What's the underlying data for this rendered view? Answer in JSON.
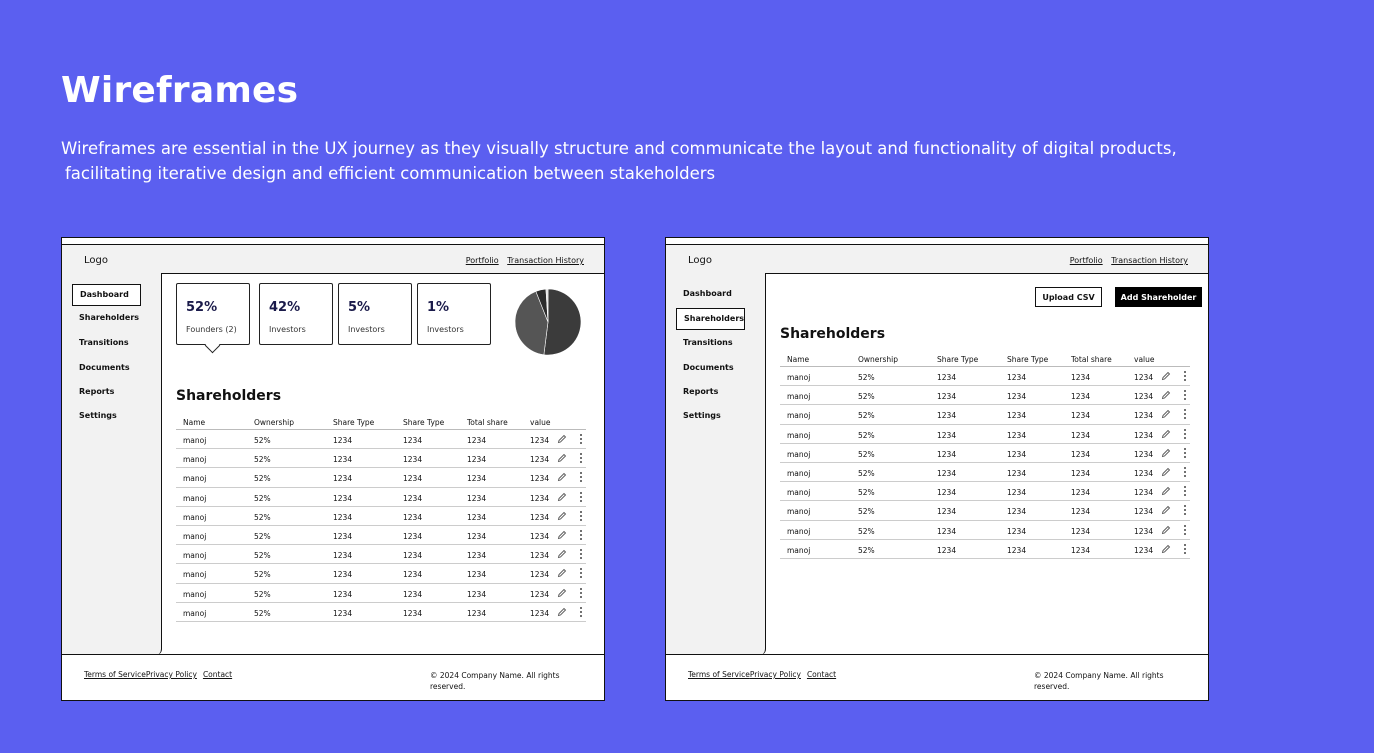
{
  "heading": {
    "title": "Wireframes",
    "description_line1": "Wireframes are essential in the UX journey as they visually structure and communicate the layout and functionality of digital products,",
    "description_line2": "facilitating iterative design and efficient communication between stakeholders"
  },
  "shared": {
    "logo": "Logo",
    "nav": [
      "Portfolio",
      "Transaction History"
    ],
    "sidebar": [
      "Dashboard",
      "Shareholders",
      "Transitions",
      "Documents",
      "Reports",
      "Settings"
    ],
    "footer": {
      "terms": "Terms of Service",
      "privacy": "Privacy Policy",
      "contact": "Contact",
      "copyright": "© 2024 Company Name. All rights reserved."
    },
    "table_title": "Shareholders",
    "columns": [
      "Name",
      "Ownership",
      "Share Type",
      "Share Type",
      "Total share",
      "value"
    ],
    "rows": [
      [
        "manoj",
        "52%",
        "1234",
        "1234",
        "1234",
        "1234"
      ],
      [
        "manoj",
        "52%",
        "1234",
        "1234",
        "1234",
        "1234"
      ],
      [
        "manoj",
        "52%",
        "1234",
        "1234",
        "1234",
        "1234"
      ],
      [
        "manoj",
        "52%",
        "1234",
        "1234",
        "1234",
        "1234"
      ],
      [
        "manoj",
        "52%",
        "1234",
        "1234",
        "1234",
        "1234"
      ],
      [
        "manoj",
        "52%",
        "1234",
        "1234",
        "1234",
        "1234"
      ],
      [
        "manoj",
        "52%",
        "1234",
        "1234",
        "1234",
        "1234"
      ],
      [
        "manoj",
        "52%",
        "1234",
        "1234",
        "1234",
        "1234"
      ],
      [
        "manoj",
        "52%",
        "1234",
        "1234",
        "1234",
        "1234"
      ],
      [
        "manoj",
        "52%",
        "1234",
        "1234",
        "1234",
        "1234"
      ]
    ],
    "row_action_icons": [
      "pencil-icon",
      "more-vertical-icon"
    ]
  },
  "dashboard": {
    "active_sidebar": "Dashboard",
    "stats": [
      {
        "value": "52%",
        "label": "Founders (2)"
      },
      {
        "value": "42%",
        "label": "Investors"
      },
      {
        "value": "5%",
        "label": "Investors"
      },
      {
        "value": "1%",
        "label": "Investors"
      }
    ],
    "pie": {
      "values": [
        52,
        42,
        5,
        1
      ],
      "colors": [
        "#3b3b3b",
        "#555555",
        "#2c2c2c",
        "#dddddd"
      ]
    }
  },
  "shareholders_page": {
    "active_sidebar": "Shareholders",
    "upload_button": "Upload CSV",
    "add_button": "Add Shareholder"
  },
  "colors": {
    "background": "#5b5ff0",
    "panel": "#f2f2f2"
  }
}
